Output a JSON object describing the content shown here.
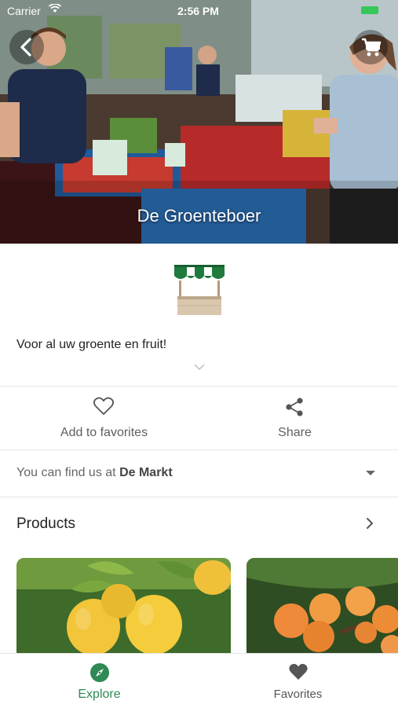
{
  "status_bar": {
    "carrier": "Carrier",
    "time": "2:56 PM"
  },
  "header": {
    "title": "De Groenteboer",
    "back_icon": "chevron-left-icon",
    "cart_icon": "cart-icon"
  },
  "shop": {
    "logo_icon": "market-stall-icon",
    "description": "Voor al uw groente en fruit!"
  },
  "actions": {
    "favorite_label": "Add to favorites",
    "share_label": "Share"
  },
  "location": {
    "prefix": "You can find us at",
    "market": "De Markt"
  },
  "products": {
    "title": "Products",
    "items": [
      {
        "image": "lemons-photo"
      },
      {
        "image": "apricots-photo"
      }
    ]
  },
  "tabs": [
    {
      "label": "Explore",
      "icon": "compass-icon",
      "active": true
    },
    {
      "label": "Favorites",
      "icon": "heart-icon",
      "active": false
    }
  ],
  "colors": {
    "accent": "#2f8a55",
    "awning_green": "#1f7a3e",
    "battery": "#35c759"
  }
}
